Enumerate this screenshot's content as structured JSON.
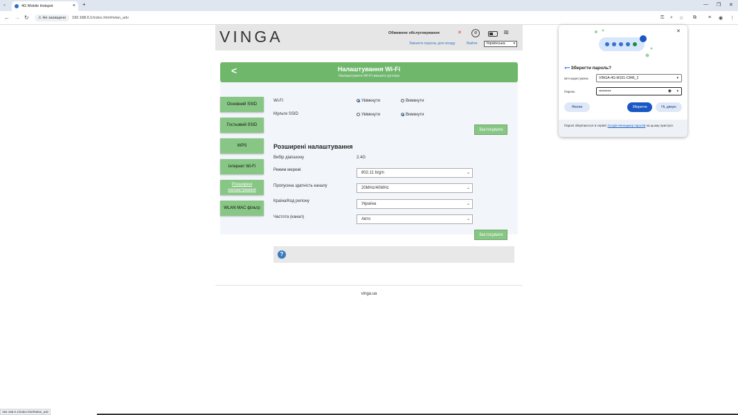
{
  "browser": {
    "tab_title": "4G Mobile Hotspot",
    "tab_close": "×",
    "new_tab": "+",
    "security": "Не захищено",
    "url_host": "192.168.0.1",
    "url_path": "/index.html#wlan_adv",
    "status_url": "192.168.0.1/index.html#wlan_adv"
  },
  "header": {
    "logo": "VINGA",
    "maintenance": "Обмежене обслуговування",
    "change_password": "Змінити пароль для входу",
    "logout": "Вийти",
    "language": "Українська"
  },
  "banner": {
    "title": "Налаштування Wi-Fi",
    "subtitle": "Налаштувати Wi-Fi вашого рутера"
  },
  "sidebar": {
    "items": [
      {
        "label": "Основний SSID"
      },
      {
        "label": "Гостьовий SSID"
      },
      {
        "label": "WPS"
      },
      {
        "label": "Інтернет Wi-Fi"
      },
      {
        "label": "Розширені налаштування"
      },
      {
        "label": "WLAN MAC фільтр"
      }
    ]
  },
  "basic": {
    "wifi_label": "Wi-Fi",
    "multi_ssid_label": "Мульти SSID",
    "on": "Увімкнути",
    "off": "Вимкнути",
    "wifi_value": "on",
    "multi_ssid_value": "off",
    "apply": "Застосувати"
  },
  "advanced": {
    "title": "Розширені налаштування",
    "band_label": "Вибір діапазону",
    "band_value": "2.4G",
    "mode_label": "Режим мережі",
    "mode_value": "802.11 b/g/n",
    "bandwidth_label": "Пропускна здатність каналу",
    "bandwidth_value": "20MHz/40MHz",
    "country_label": "Країна/Код регіону",
    "country_value": "Україна",
    "channel_label": "Частота (канал)",
    "channel_value": "Авто",
    "apply": "Застосувати"
  },
  "help": {
    "icon": "?"
  },
  "footer": {
    "site": "vinga.ua"
  },
  "password_popup": {
    "title": "Зберегти пароль?",
    "username_label": "Ім'я користувача",
    "username_value": "VINGA-4G-M101-C846_2",
    "password_label": "Пароль",
    "password_value": "••••••••••",
    "never": "Ніколи",
    "save": "Зберегти",
    "no_thanks": "Ні, дякую",
    "note_prefix": "Паролі зберігаються в сервісі ",
    "note_link": "Google Менеджер паролів",
    "note_suffix": " на цьому пристрої.",
    "accent": "#1a56c4"
  },
  "colors": {
    "green": "#6fb86b",
    "side_green": "#87c684",
    "link": "#3a7abf"
  }
}
